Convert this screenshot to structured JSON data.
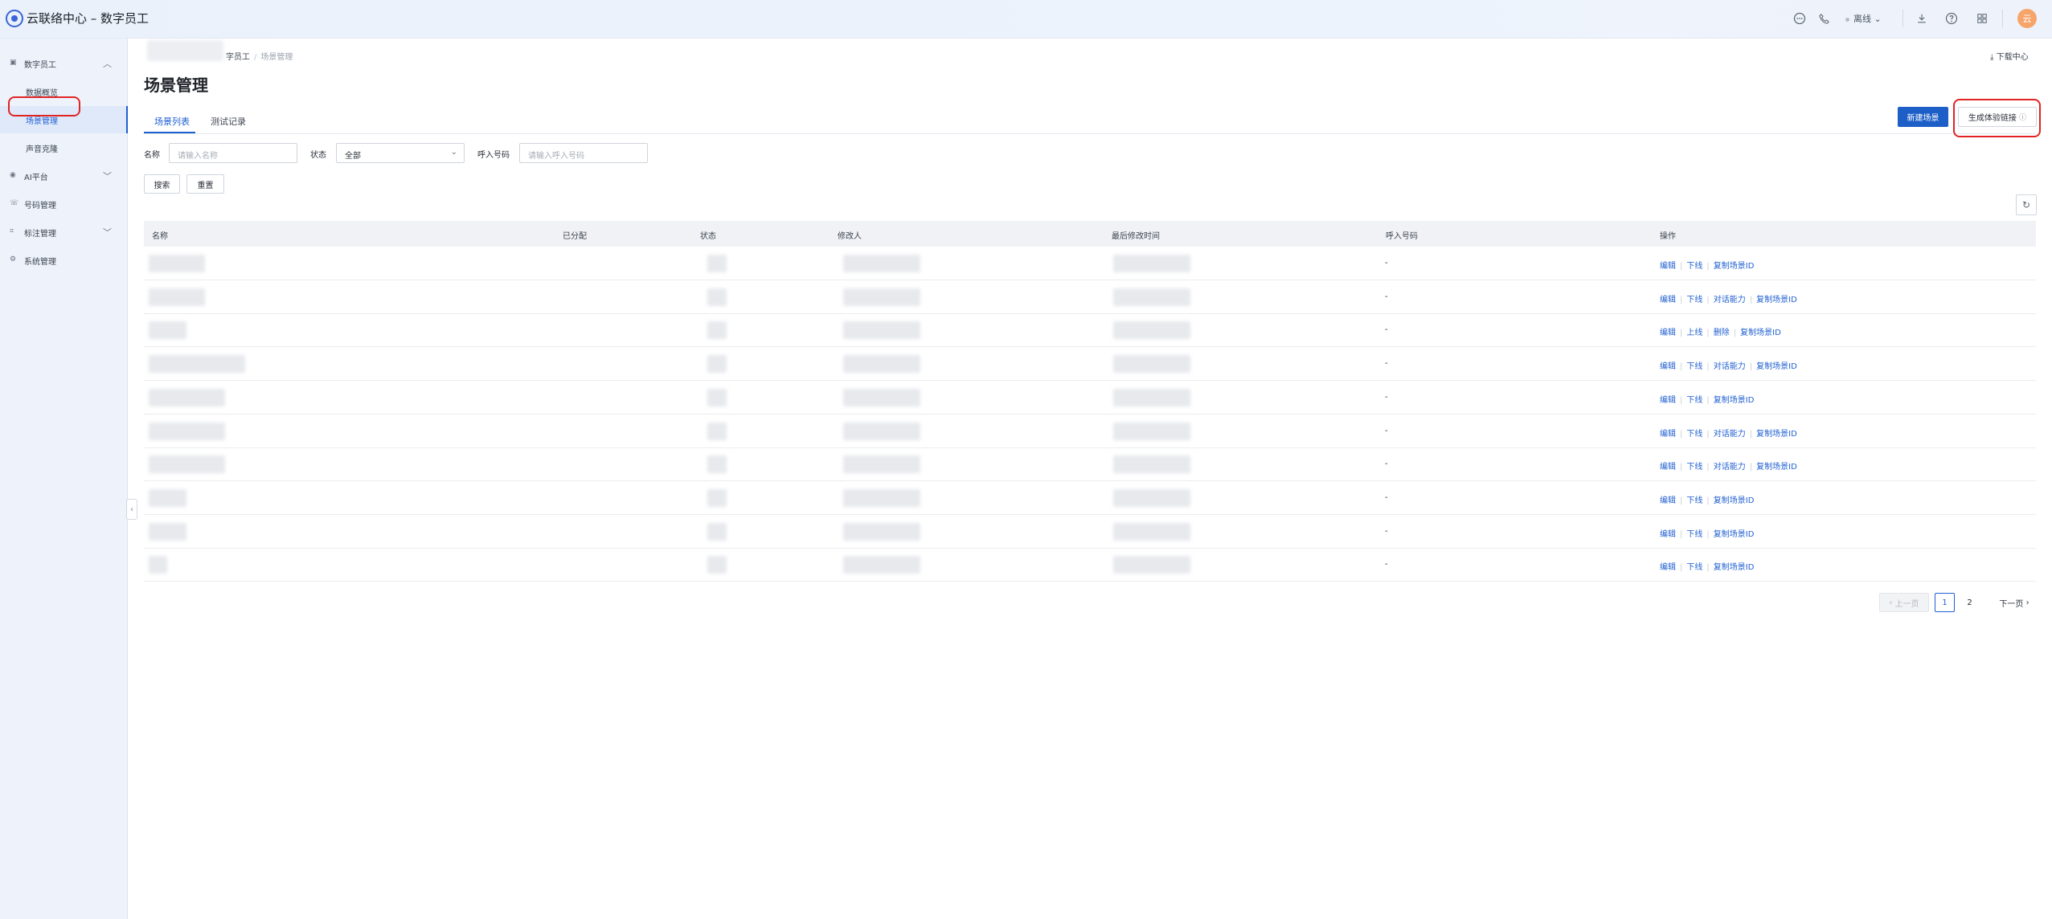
{
  "header": {
    "app_title": "云联络中心 – 数字员工",
    "status_label": "离线",
    "avatar_text": "云"
  },
  "sidebar": {
    "items": [
      {
        "label": "数字员工",
        "icon": "robot-icon"
      },
      {
        "label": "数据概览"
      },
      {
        "label": "场景管理"
      },
      {
        "label": "声音克隆"
      },
      {
        "label": "AI平台",
        "icon": "eye-icon"
      },
      {
        "label": "号码管理",
        "icon": "phone-icon"
      },
      {
        "label": "标注管理",
        "icon": "tag-icon"
      },
      {
        "label": "系统管理",
        "icon": "gear-icon"
      }
    ]
  },
  "breadcrumb": {
    "parent": "字员工",
    "current": "场景管理"
  },
  "download_center": "下载中心",
  "page_title": "场景管理",
  "tabs": [
    {
      "label": "场景列表"
    },
    {
      "label": "测试记录"
    }
  ],
  "actions": {
    "new_scene": "新建场景",
    "gen_link": "生成体验链接"
  },
  "filters": {
    "name_label": "名称",
    "name_placeholder": "请输入名称",
    "status_label": "状态",
    "status_value": "全部",
    "number_label": "呼入号码",
    "number_placeholder": "请输入呼入号码",
    "search": "搜索",
    "reset": "重置"
  },
  "table": {
    "columns": [
      "名称",
      "已分配",
      "状态",
      "修改人",
      "最后修改时间",
      "呼入号码",
      "操作"
    ],
    "rows": [
      {
        "number": "-",
        "ops": [
          "编辑",
          "下线",
          "复制场景ID"
        ]
      },
      {
        "number": "-",
        "ops": [
          "编辑",
          "下线",
          "对话能力",
          "复制场景ID"
        ]
      },
      {
        "number": "-",
        "ops": [
          "编辑",
          "上线",
          "删除",
          "复制场景ID"
        ]
      },
      {
        "number": "-",
        "ops": [
          "编辑",
          "下线",
          "对话能力",
          "复制场景ID"
        ]
      },
      {
        "number": "-",
        "ops": [
          "编辑",
          "下线",
          "复制场景ID"
        ]
      },
      {
        "number": "-",
        "ops": [
          "编辑",
          "下线",
          "对话能力",
          "复制场景ID"
        ]
      },
      {
        "number": "-",
        "ops": [
          "编辑",
          "下线",
          "对话能力",
          "复制场景ID"
        ]
      },
      {
        "number": "-",
        "ops": [
          "编辑",
          "下线",
          "复制场景ID"
        ]
      },
      {
        "number": "-",
        "ops": [
          "编辑",
          "下线",
          "复制场景ID"
        ]
      },
      {
        "number": "-",
        "ops": [
          "编辑",
          "下线",
          "复制场景ID"
        ]
      }
    ]
  },
  "pagination": {
    "prev": "上一页",
    "pages": [
      "1",
      "2"
    ],
    "current": "1",
    "next": "下一页"
  },
  "colors": {
    "primary": "#1d5fc7",
    "link": "#1f5fd1",
    "highlight": "#e02424"
  }
}
